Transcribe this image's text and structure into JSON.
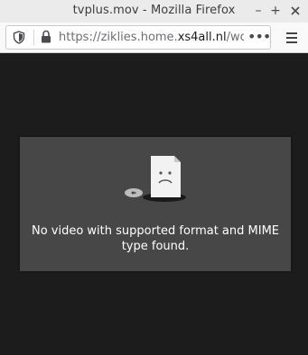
{
  "window": {
    "title": "tvplus.mov - Mozilla Firefox",
    "minimize": "–",
    "maximize": "+"
  },
  "urlbar": {
    "scheme": "https://",
    "subdomain": "ziklies.home.",
    "domain": "xs4all.nl",
    "path": "/woo",
    "page_actions": "•••"
  },
  "icons": {
    "shield": "shield-icon",
    "lock": "lock-icon",
    "menu": "hamburger-menu-icon",
    "error": "sad-file-icon"
  },
  "video_error": {
    "message": "No video with supported format and MIME type found."
  },
  "colors": {
    "page_background": "#1c1c1c",
    "panel_background": "#474747",
    "titlebar": "#ebebeb"
  }
}
